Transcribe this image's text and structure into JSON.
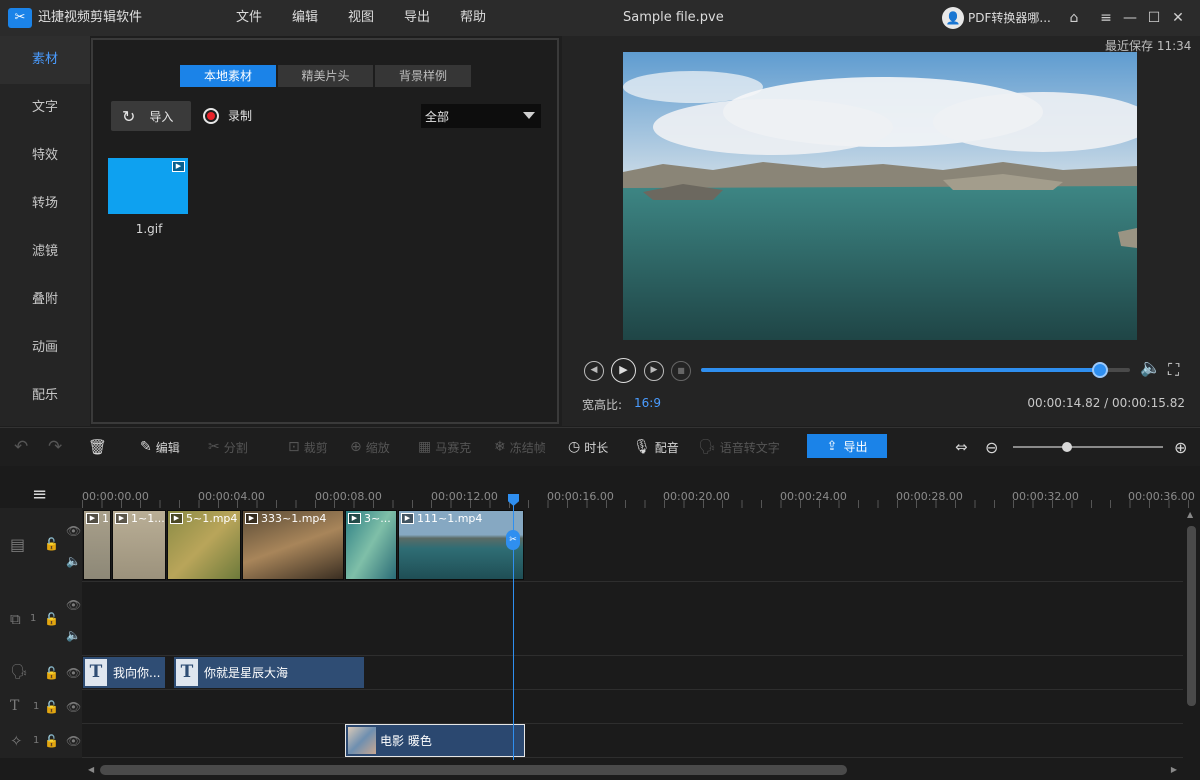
{
  "app": {
    "title": "迅捷视频剪辑软件",
    "file_name": "Sample file.pve",
    "user": "PDF转换器哪..."
  },
  "menu": [
    "文件",
    "编辑",
    "视图",
    "导出",
    "帮助"
  ],
  "sidebar": {
    "items": [
      {
        "label": "素材",
        "active": true
      },
      {
        "label": "文字"
      },
      {
        "label": "特效"
      },
      {
        "label": "转场"
      },
      {
        "label": "滤镜"
      },
      {
        "label": "叠附"
      },
      {
        "label": "动画"
      },
      {
        "label": "配乐"
      }
    ]
  },
  "media": {
    "tabs": [
      "本地素材",
      "精美片头",
      "背景样例"
    ],
    "import_label": "导入",
    "record_label": "录制",
    "filter_value": "全部",
    "files": [
      {
        "name": "1.gif"
      }
    ]
  },
  "preview": {
    "last_saved": "最近保存 11:34",
    "aspect_label": "宽高比:",
    "aspect_value": "16:9",
    "time_display": "00:00:14.82 / 00:00:15.82",
    "progress": 0.93
  },
  "toolbar": {
    "edit": "编辑",
    "split": "分割",
    "crop": "裁剪",
    "zoom": "缩放",
    "mosaic": "马赛克",
    "freeze": "冻结帧",
    "duration": "时长",
    "dub": "配音",
    "speech_to_text": "语音转文字",
    "export": "导出",
    "zoom_level": 0.36
  },
  "timeline": {
    "ticks": [
      "00:00:00.00",
      "00:00:04.00",
      "00:00:08.00",
      "00:00:12.00",
      "00:00:16.00",
      "00:00:20.00",
      "00:00:24.00",
      "00:00:28.00",
      "00:00:32.00",
      "00:00:36.00"
    ],
    "video_clips": [
      "1",
      "1~1...",
      "5~1.mp4",
      "333~1.mp4",
      "3~...",
      "111~1.mp4"
    ],
    "track_numbers": {
      "pip": "1",
      "text": "1",
      "effect": "1"
    },
    "text_clips": [
      "我向你...",
      "你就是星辰大海"
    ],
    "effect_clip": "电影 暖色"
  }
}
